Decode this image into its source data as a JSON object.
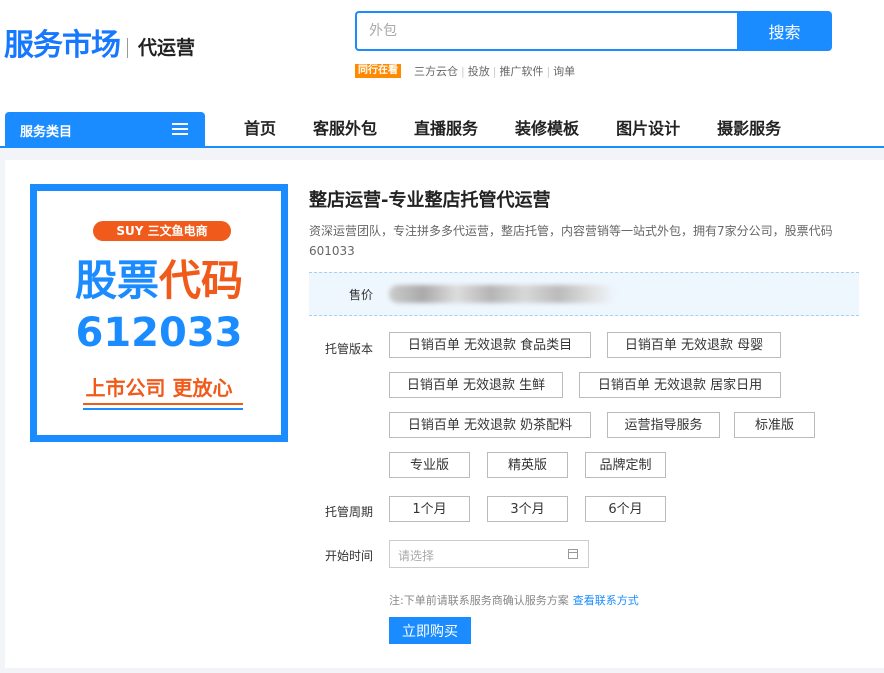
{
  "header": {
    "logo": "服务市场",
    "logo_sub": "代运营",
    "search_placeholder": "外包",
    "search_button": "搜索",
    "hot_badge": "同行在看",
    "hot_links": [
      "三方云仓",
      "投放",
      "推广软件",
      "询单"
    ]
  },
  "nav": {
    "category_label": "服务类目",
    "items": [
      "首页",
      "客服外包",
      "直播服务",
      "装修模板",
      "图片设计",
      "摄影服务"
    ]
  },
  "product": {
    "image": {
      "brand": "SUY 三文鱼电商",
      "line1_a": "股票",
      "line1_b": "代码",
      "line2": "612033",
      "line3": "上市公司 更放心"
    },
    "title": "整店运营-专业整店托管代运营",
    "description": "资深运营团队，专注拼多多代运营，整店托管，内容营销等一站式外包，拥有7家分公司，股票代码601033",
    "price_label": "售价",
    "version_label": "托管版本",
    "versions": [
      "日销百单 无效退款 食品类目",
      "日销百单 无效退款 母婴",
      "日销百单 无效退款 生鲜",
      "日销百单 无效退款 居家日用",
      "日销百单 无效退款 奶茶配料",
      "运营指导服务",
      "标准版",
      "专业版",
      "精英版",
      "品牌定制"
    ],
    "period_label": "托管周期",
    "periods": [
      "1个月",
      "3个月",
      "6个月"
    ],
    "start_label": "开始时间",
    "start_placeholder": "请选择",
    "note": "注:下单前请联系服务商确认服务方案",
    "note_link": "查看联系方式",
    "buy_button": "立即购买"
  }
}
